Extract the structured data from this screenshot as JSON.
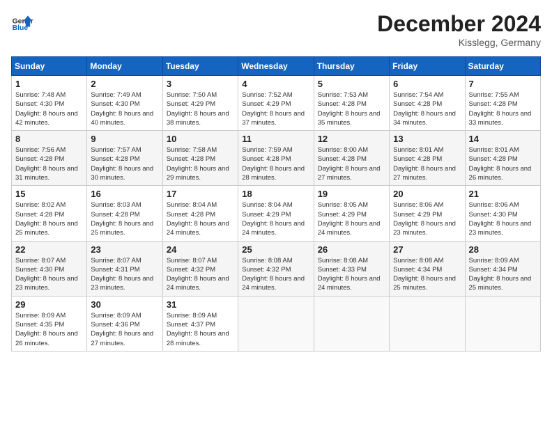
{
  "header": {
    "logo_line1": "General",
    "logo_line2": "Blue",
    "month": "December 2024",
    "location": "Kisslegg, Germany"
  },
  "weekdays": [
    "Sunday",
    "Monday",
    "Tuesday",
    "Wednesday",
    "Thursday",
    "Friday",
    "Saturday"
  ],
  "weeks": [
    [
      {
        "day": "1",
        "sunrise": "Sunrise: 7:48 AM",
        "sunset": "Sunset: 4:30 PM",
        "daylight": "Daylight: 8 hours and 42 minutes."
      },
      {
        "day": "2",
        "sunrise": "Sunrise: 7:49 AM",
        "sunset": "Sunset: 4:30 PM",
        "daylight": "Daylight: 8 hours and 40 minutes."
      },
      {
        "day": "3",
        "sunrise": "Sunrise: 7:50 AM",
        "sunset": "Sunset: 4:29 PM",
        "daylight": "Daylight: 8 hours and 38 minutes."
      },
      {
        "day": "4",
        "sunrise": "Sunrise: 7:52 AM",
        "sunset": "Sunset: 4:29 PM",
        "daylight": "Daylight: 8 hours and 37 minutes."
      },
      {
        "day": "5",
        "sunrise": "Sunrise: 7:53 AM",
        "sunset": "Sunset: 4:28 PM",
        "daylight": "Daylight: 8 hours and 35 minutes."
      },
      {
        "day": "6",
        "sunrise": "Sunrise: 7:54 AM",
        "sunset": "Sunset: 4:28 PM",
        "daylight": "Daylight: 8 hours and 34 minutes."
      },
      {
        "day": "7",
        "sunrise": "Sunrise: 7:55 AM",
        "sunset": "Sunset: 4:28 PM",
        "daylight": "Daylight: 8 hours and 33 minutes."
      }
    ],
    [
      {
        "day": "8",
        "sunrise": "Sunrise: 7:56 AM",
        "sunset": "Sunset: 4:28 PM",
        "daylight": "Daylight: 8 hours and 31 minutes."
      },
      {
        "day": "9",
        "sunrise": "Sunrise: 7:57 AM",
        "sunset": "Sunset: 4:28 PM",
        "daylight": "Daylight: 8 hours and 30 minutes."
      },
      {
        "day": "10",
        "sunrise": "Sunrise: 7:58 AM",
        "sunset": "Sunset: 4:28 PM",
        "daylight": "Daylight: 8 hours and 29 minutes."
      },
      {
        "day": "11",
        "sunrise": "Sunrise: 7:59 AM",
        "sunset": "Sunset: 4:28 PM",
        "daylight": "Daylight: 8 hours and 28 minutes."
      },
      {
        "day": "12",
        "sunrise": "Sunrise: 8:00 AM",
        "sunset": "Sunset: 4:28 PM",
        "daylight": "Daylight: 8 hours and 27 minutes."
      },
      {
        "day": "13",
        "sunrise": "Sunrise: 8:01 AM",
        "sunset": "Sunset: 4:28 PM",
        "daylight": "Daylight: 8 hours and 27 minutes."
      },
      {
        "day": "14",
        "sunrise": "Sunrise: 8:01 AM",
        "sunset": "Sunset: 4:28 PM",
        "daylight": "Daylight: 8 hours and 26 minutes."
      }
    ],
    [
      {
        "day": "15",
        "sunrise": "Sunrise: 8:02 AM",
        "sunset": "Sunset: 4:28 PM",
        "daylight": "Daylight: 8 hours and 25 minutes."
      },
      {
        "day": "16",
        "sunrise": "Sunrise: 8:03 AM",
        "sunset": "Sunset: 4:28 PM",
        "daylight": "Daylight: 8 hours and 25 minutes."
      },
      {
        "day": "17",
        "sunrise": "Sunrise: 8:04 AM",
        "sunset": "Sunset: 4:28 PM",
        "daylight": "Daylight: 8 hours and 24 minutes."
      },
      {
        "day": "18",
        "sunrise": "Sunrise: 8:04 AM",
        "sunset": "Sunset: 4:29 PM",
        "daylight": "Daylight: 8 hours and 24 minutes."
      },
      {
        "day": "19",
        "sunrise": "Sunrise: 8:05 AM",
        "sunset": "Sunset: 4:29 PM",
        "daylight": "Daylight: 8 hours and 24 minutes."
      },
      {
        "day": "20",
        "sunrise": "Sunrise: 8:06 AM",
        "sunset": "Sunset: 4:29 PM",
        "daylight": "Daylight: 8 hours and 23 minutes."
      },
      {
        "day": "21",
        "sunrise": "Sunrise: 8:06 AM",
        "sunset": "Sunset: 4:30 PM",
        "daylight": "Daylight: 8 hours and 23 minutes."
      }
    ],
    [
      {
        "day": "22",
        "sunrise": "Sunrise: 8:07 AM",
        "sunset": "Sunset: 4:30 PM",
        "daylight": "Daylight: 8 hours and 23 minutes."
      },
      {
        "day": "23",
        "sunrise": "Sunrise: 8:07 AM",
        "sunset": "Sunset: 4:31 PM",
        "daylight": "Daylight: 8 hours and 23 minutes."
      },
      {
        "day": "24",
        "sunrise": "Sunrise: 8:07 AM",
        "sunset": "Sunset: 4:32 PM",
        "daylight": "Daylight: 8 hours and 24 minutes."
      },
      {
        "day": "25",
        "sunrise": "Sunrise: 8:08 AM",
        "sunset": "Sunset: 4:32 PM",
        "daylight": "Daylight: 8 hours and 24 minutes."
      },
      {
        "day": "26",
        "sunrise": "Sunrise: 8:08 AM",
        "sunset": "Sunset: 4:33 PM",
        "daylight": "Daylight: 8 hours and 24 minutes."
      },
      {
        "day": "27",
        "sunrise": "Sunrise: 8:08 AM",
        "sunset": "Sunset: 4:34 PM",
        "daylight": "Daylight: 8 hours and 25 minutes."
      },
      {
        "day": "28",
        "sunrise": "Sunrise: 8:09 AM",
        "sunset": "Sunset: 4:34 PM",
        "daylight": "Daylight: 8 hours and 25 minutes."
      }
    ],
    [
      {
        "day": "29",
        "sunrise": "Sunrise: 8:09 AM",
        "sunset": "Sunset: 4:35 PM",
        "daylight": "Daylight: 8 hours and 26 minutes."
      },
      {
        "day": "30",
        "sunrise": "Sunrise: 8:09 AM",
        "sunset": "Sunset: 4:36 PM",
        "daylight": "Daylight: 8 hours and 27 minutes."
      },
      {
        "day": "31",
        "sunrise": "Sunrise: 8:09 AM",
        "sunset": "Sunset: 4:37 PM",
        "daylight": "Daylight: 8 hours and 28 minutes."
      },
      null,
      null,
      null,
      null
    ]
  ]
}
